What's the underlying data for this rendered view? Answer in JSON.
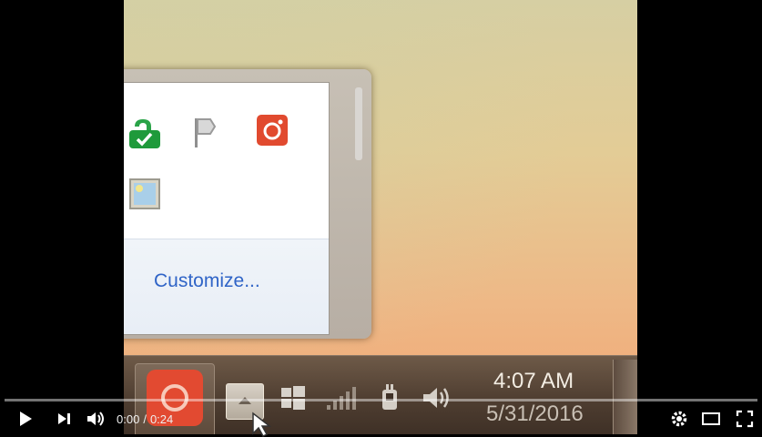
{
  "tray_popup": {
    "customize_label": "Customize...",
    "icons": [
      "security-check-icon",
      "action-center-flag-icon",
      "app-red-icon",
      "image-icon"
    ]
  },
  "taskbar": {
    "pinned_app_icon": "red-camera-app-icon",
    "show_hidden_icon": "chevron-up-icon",
    "tray_icons": [
      "windows-flag-icon",
      "network-signal-icon",
      "power-plug-icon",
      "volume-icon"
    ],
    "clock": {
      "time": "4:07 AM",
      "date": "5/31/2016"
    }
  },
  "player": {
    "current_time": "0:00",
    "separator": "/",
    "duration": "0:24",
    "progress": 0.0,
    "buttons": [
      "play-icon",
      "next-icon",
      "volume-icon",
      "settings-icon",
      "theater-icon",
      "fullscreen-icon"
    ]
  }
}
